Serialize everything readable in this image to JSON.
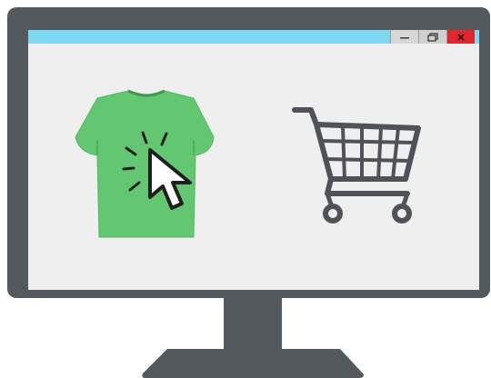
{
  "window": {
    "controls": [
      "minimize",
      "maximize",
      "close"
    ]
  },
  "icons": {
    "product": "t-shirt-icon",
    "cursor": "cursor-arrow-icon",
    "cart": "shopping-cart-icon"
  },
  "colors": {
    "monitor_frame": "#54595e",
    "screen": "#efefef",
    "titlebar": "#7dd8f2",
    "shirt": "#62c770",
    "close_button": "#e0252b",
    "cart": "#4f5257"
  }
}
